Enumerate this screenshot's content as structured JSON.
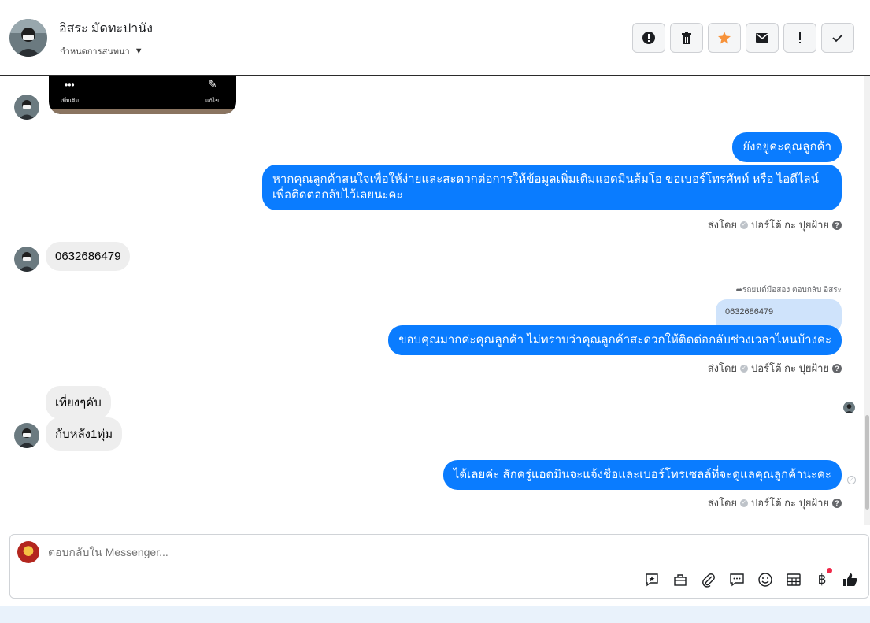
{
  "header": {
    "name": "อิสระ มัดทะปานัง",
    "assign_label": "กำหนดการสนทนา",
    "actions": [
      {
        "icon": "alert-circle-icon",
        "label": "spam"
      },
      {
        "icon": "trash-icon",
        "label": "delete"
      },
      {
        "icon": "star-icon",
        "label": "star"
      },
      {
        "icon": "envelope-icon",
        "label": "mark-unread"
      },
      {
        "icon": "exclamation-icon",
        "label": "follow-up"
      },
      {
        "icon": "check-icon",
        "label": "done"
      }
    ],
    "star_color": "#f7923a"
  },
  "image_card": {
    "more_label": "เพิ่มเติม",
    "edit_label": "แก้ไข"
  },
  "messages": {
    "out1": "ยังอยู่ค่ะคุณลูกค้า",
    "out2": "หากคุณลูกค้าสนใจเพื่อให้ง่ายและสะดวกต่อการให้ข้อมูลเพิ่มเติมแอดมินส้มโอ ขอเบอร์โทรศัพท์ หรือ ไอดีไลน์ เพื่อติดต่อกลับไว้เลยนะคะ",
    "in1": "0632686479",
    "reply_hint": "รถยนต์มือสอง ตอบกลับ อิสระ",
    "quoted": "0632686479",
    "out3": "ขอบคุณมากค่ะคุณลูกค้า ไม่ทราบว่าคุณลูกค้าสะดวกให้ติดต่อกลับช่วงเวลาไหนบ้างคะ",
    "in2": "เที่ยงๆคับ",
    "in3": "กับหลัง1ทุ่ม",
    "out4": "ได้เลยค่ะ สักครู่แอดมินจะแจ้งชื่อและเบอร์โทรเซลล์ที่จะดูแลคุณลูกค้านะคะ"
  },
  "meta": {
    "sent_by_prefix": "ส่งโดย",
    "sender": "ปอร์โต้ กะ ปุยฝ้าย"
  },
  "composer": {
    "placeholder": "ตอบกลับใน Messenger...",
    "tools": [
      "saved-reply-icon",
      "shop-icon",
      "paperclip-icon",
      "chat-bubble-icon",
      "emoji-icon",
      "table-icon",
      "baht-icon",
      "like-icon"
    ]
  },
  "colors": {
    "bubble_out": "#0a7cff",
    "bubble_in": "#eeeeee"
  }
}
